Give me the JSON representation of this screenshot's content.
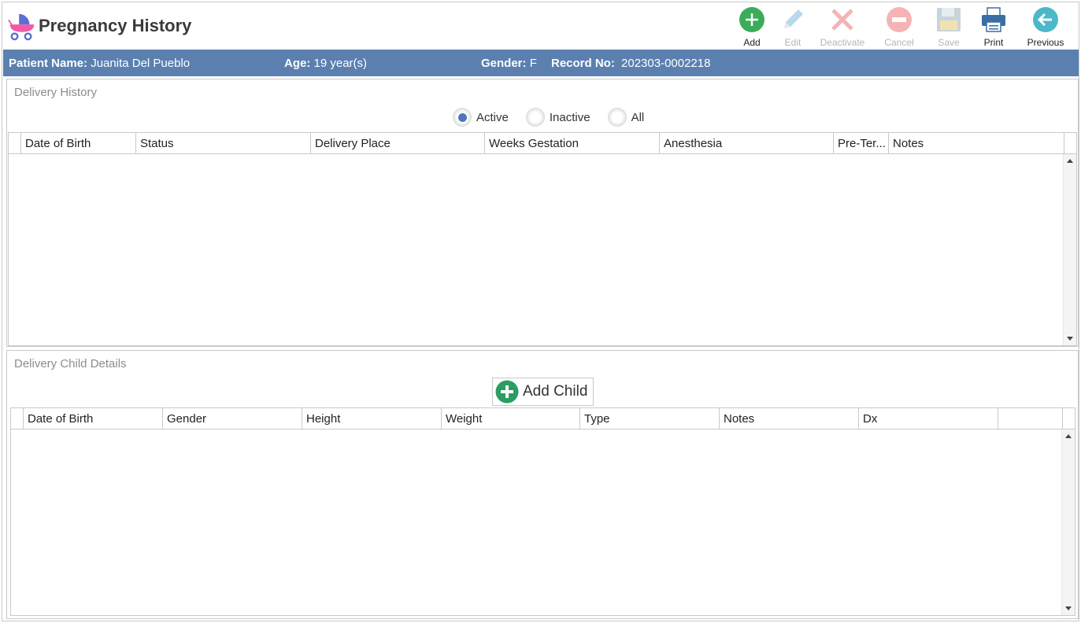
{
  "header": {
    "title": "Pregnancy History",
    "app_icon": "baby-carriage-icon"
  },
  "toolbar": {
    "add": {
      "label": "Add",
      "icon": "add-circle-icon",
      "enabled": true
    },
    "edit": {
      "label": "Edit",
      "icon": "pencil-icon",
      "enabled": false
    },
    "deactivate": {
      "label": "Deactivate",
      "icon": "x-icon",
      "enabled": false
    },
    "cancel": {
      "label": "Cancel",
      "icon": "minus-circle-icon",
      "enabled": false
    },
    "save": {
      "label": "Save",
      "icon": "floppy-disk-icon",
      "enabled": false
    },
    "print": {
      "label": "Print",
      "icon": "printer-icon",
      "enabled": true
    },
    "previous": {
      "label": "Previous",
      "icon": "back-arrow-icon",
      "enabled": true
    }
  },
  "patient": {
    "name_label": "Patient Name:",
    "name": "Juanita Del Pueblo",
    "age_label": "Age:",
    "age": "19 year(s)",
    "gender_label": "Gender:",
    "gender": "F",
    "record_label": "Record No:",
    "record": "202303-0002218"
  },
  "delivery_history": {
    "title": "Delivery History",
    "filters": [
      {
        "label": "Active",
        "selected": true
      },
      {
        "label": "Inactive",
        "selected": false
      },
      {
        "label": "All",
        "selected": false
      }
    ],
    "columns": [
      "Date of Birth",
      "Status",
      "Delivery Place",
      "Weeks Gestation",
      "Anesthesia",
      "Pre-Ter...",
      "Notes"
    ],
    "rows": []
  },
  "delivery_child": {
    "title": "Delivery Child Details",
    "add_child_label": "Add Child",
    "columns": [
      "Date of Birth",
      "Gender",
      "Height",
      "Weight",
      "Type",
      "Notes",
      "Dx"
    ],
    "rows": []
  },
  "colors": {
    "header_bar": "#5b80b0",
    "add_green": "#3cac5a",
    "previous_teal": "#4bb8c8",
    "radio_selected": "#4e78b8"
  }
}
